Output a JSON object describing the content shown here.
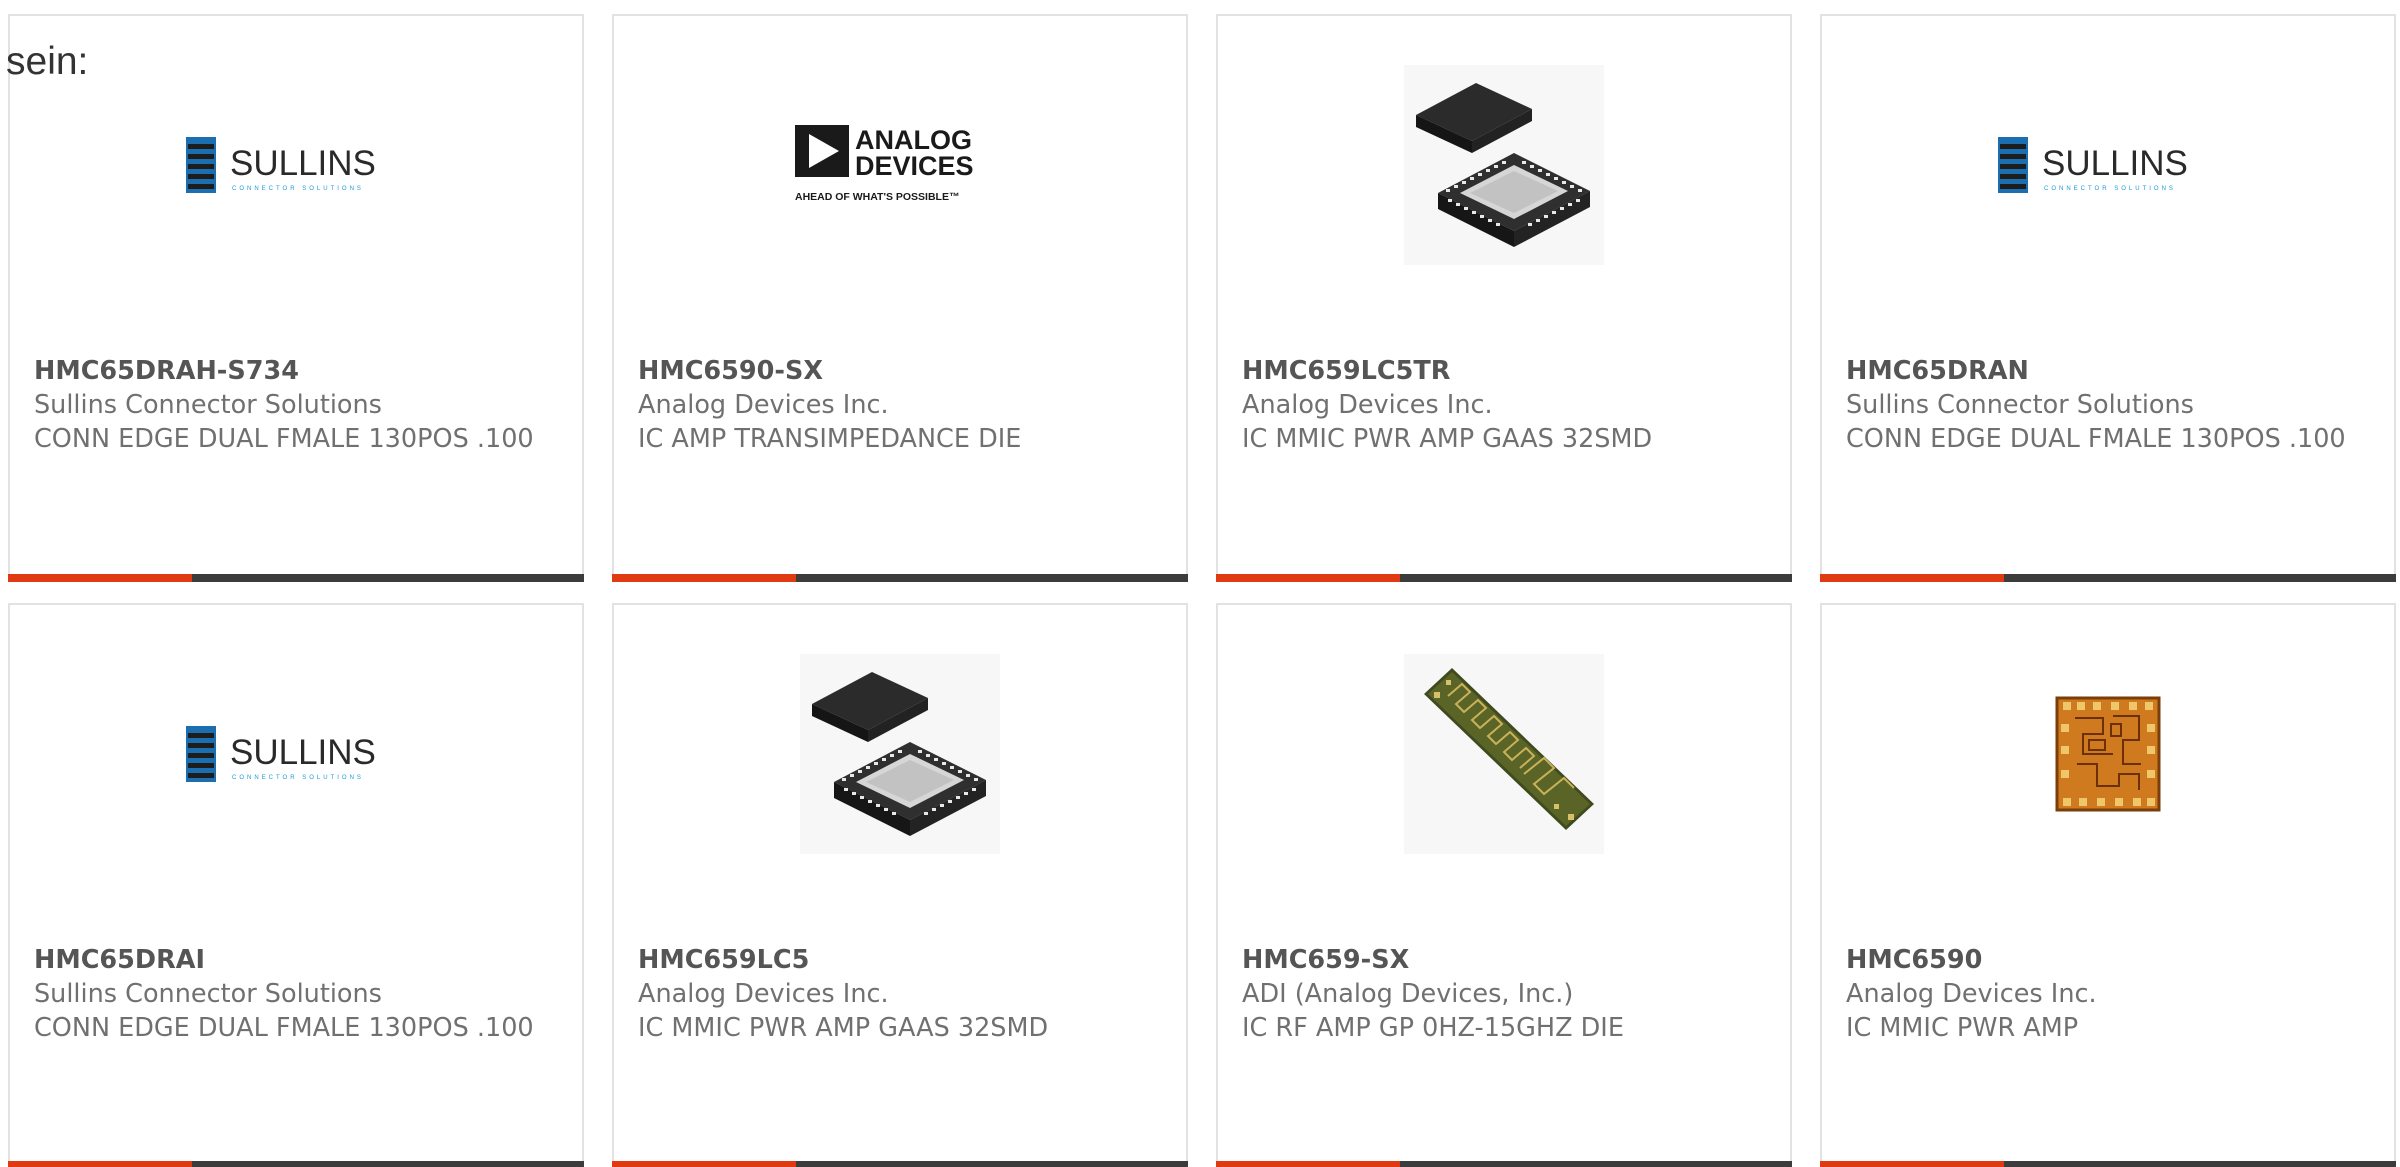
{
  "intro_text": "sein:",
  "colors": {
    "accent": "#e03a12",
    "bar": "#3c3c3c",
    "text": "#707070",
    "border": "#e2e2e2",
    "sullins_blue": "#1b6fb0",
    "adi_black": "#1a1a1a"
  },
  "products": [
    {
      "part": "HMC65DRAH-S734",
      "manufacturer": "Sullins Connector Solutions",
      "description": "CONN EDGE DUAL FMALE 130POS .100",
      "image": "sullins-logo",
      "logo_text": "SULLINS",
      "logo_tagline": "CONNECTOR SOLUTIONS"
    },
    {
      "part": "HMC6590-SX",
      "manufacturer": "Analog Devices Inc.",
      "description": "IC AMP TRANSIMPEDANCE DIE",
      "image": "analog-devices-logo",
      "logo_text_1": "ANALOG",
      "logo_text_2": "DEVICES",
      "logo_tagline": "AHEAD OF WHAT'S POSSIBLE™"
    },
    {
      "part": "HMC659LC5TR",
      "manufacturer": "Analog Devices Inc.",
      "description": "IC MMIC PWR AMP GAAS 32SMD",
      "image": "qfn-package-photo"
    },
    {
      "part": "HMC65DRAN",
      "manufacturer": "Sullins Connector Solutions",
      "description": "CONN EDGE DUAL FMALE 130POS .100",
      "image": "sullins-logo",
      "logo_text": "SULLINS",
      "logo_tagline": "CONNECTOR SOLUTIONS"
    },
    {
      "part": "HMC65DRAI",
      "manufacturer": "Sullins Connector Solutions",
      "description": "CONN EDGE DUAL FMALE 130POS .100",
      "image": "sullins-logo",
      "logo_text": "SULLINS",
      "logo_tagline": "CONNECTOR SOLUTIONS"
    },
    {
      "part": "HMC659LC5",
      "manufacturer": "Analog Devices Inc.",
      "description": "IC MMIC PWR AMP GAAS 32SMD",
      "image": "qfn-package-photo"
    },
    {
      "part": "HMC659-SX",
      "manufacturer": "ADI (Analog Devices, Inc.)",
      "description": "IC RF AMP GP 0HZ-15GHZ DIE",
      "image": "die-strip-photo"
    },
    {
      "part": "HMC6590",
      "manufacturer": "Analog Devices Inc.",
      "description": "IC MMIC PWR AMP",
      "image": "die-chip-photo"
    }
  ]
}
